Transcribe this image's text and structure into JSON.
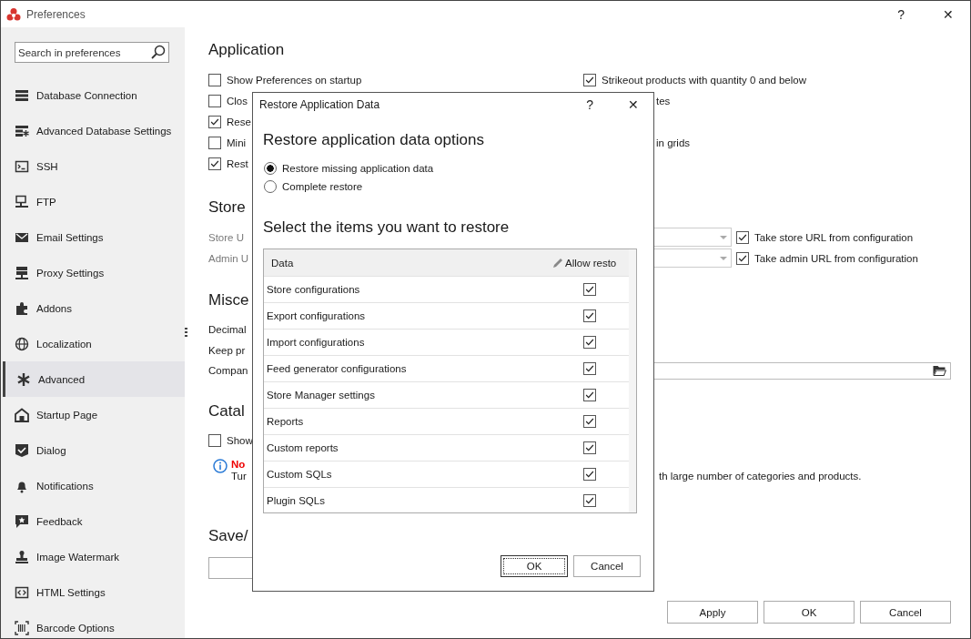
{
  "window": {
    "title": "Preferences",
    "help": "?",
    "close": "✕"
  },
  "sidebar": {
    "search": {
      "placeholder": "Search in preferences"
    },
    "items": [
      {
        "label": "Database Connection",
        "selected": false
      },
      {
        "label": "Advanced Database Settings",
        "selected": false
      },
      {
        "label": "SSH",
        "selected": false
      },
      {
        "label": "FTP",
        "selected": false
      },
      {
        "label": "Email Settings",
        "selected": false
      },
      {
        "label": "Proxy Settings",
        "selected": false
      },
      {
        "label": "Addons",
        "selected": false
      },
      {
        "label": "Localization",
        "selected": false
      },
      {
        "label": "Advanced",
        "selected": true
      },
      {
        "label": "Startup Page",
        "selected": false
      },
      {
        "label": "Dialog",
        "selected": false
      },
      {
        "label": "Notifications",
        "selected": false
      },
      {
        "label": "Feedback",
        "selected": false
      },
      {
        "label": "Image Watermark",
        "selected": false
      },
      {
        "label": "HTML Settings",
        "selected": false
      },
      {
        "label": "Barcode Options",
        "selected": false
      }
    ]
  },
  "application": {
    "title": "Application",
    "rows": [
      {
        "left": {
          "label": "Show Preferences on startup",
          "checked": false
        },
        "right": {
          "kind": "checkbox",
          "label": "Strikeout products with quantity 0 and below",
          "checked": true
        }
      },
      {
        "left": {
          "label": "Clos",
          "checked": false
        },
        "right": {
          "kind": "text",
          "label": "tes"
        }
      },
      {
        "left": {
          "label": "Rese",
          "checked": true
        }
      },
      {
        "left": {
          "label": "Mini",
          "checked": false
        },
        "right": {
          "kind": "text",
          "label": "in grids"
        }
      },
      {
        "left": {
          "label": "Rest",
          "checked": true
        }
      }
    ]
  },
  "store": {
    "title": "Store",
    "rows": [
      {
        "label": "Store U",
        "option": {
          "label": "Take store URL from configuration",
          "checked": true
        }
      },
      {
        "label": "Admin U",
        "option": {
          "label": "Take admin URL from configuration",
          "checked": true
        }
      }
    ]
  },
  "misc": {
    "title": "Misce",
    "rows": [
      {
        "kind": "label",
        "label": "Decimal"
      },
      {
        "kind": "label",
        "label": "Keep pr"
      },
      {
        "kind": "path",
        "label": "Compan"
      }
    ]
  },
  "catalog": {
    "title": "Catal",
    "option": {
      "label": "Show",
      "checked": false
    },
    "note": {
      "title": "No",
      "text": "Tur",
      "tail": "th large number of categories and products."
    }
  },
  "save": {
    "title": "Save/"
  },
  "buttons": [
    "Apply",
    "OK",
    "Cancel"
  ],
  "dialog": {
    "title": "Restore Application Data",
    "help": "?",
    "close": "✕",
    "heading": "Restore application data options",
    "modes": [
      {
        "label": "Restore missing application data",
        "selected": true
      },
      {
        "label": "Complete restore",
        "selected": false
      }
    ],
    "items_heading": "Select the items you want to restore",
    "table": {
      "columns": [
        "Data",
        "Allow resto"
      ],
      "rows": [
        {
          "name": "Store configurations",
          "checked": true
        },
        {
          "name": "Export configurations",
          "checked": true
        },
        {
          "name": "Import configurations",
          "checked": true
        },
        {
          "name": "Feed generator configurations",
          "checked": true
        },
        {
          "name": "Store Manager settings",
          "checked": true
        },
        {
          "name": "Reports",
          "checked": true
        },
        {
          "name": "Custom reports",
          "checked": true
        },
        {
          "name": "Custom SQLs",
          "checked": true
        },
        {
          "name": "Plugin SQLs",
          "checked": true
        }
      ]
    },
    "buttons": [
      {
        "label": "OK",
        "focused": true
      },
      {
        "label": "Cancel",
        "focused": false
      }
    ]
  }
}
